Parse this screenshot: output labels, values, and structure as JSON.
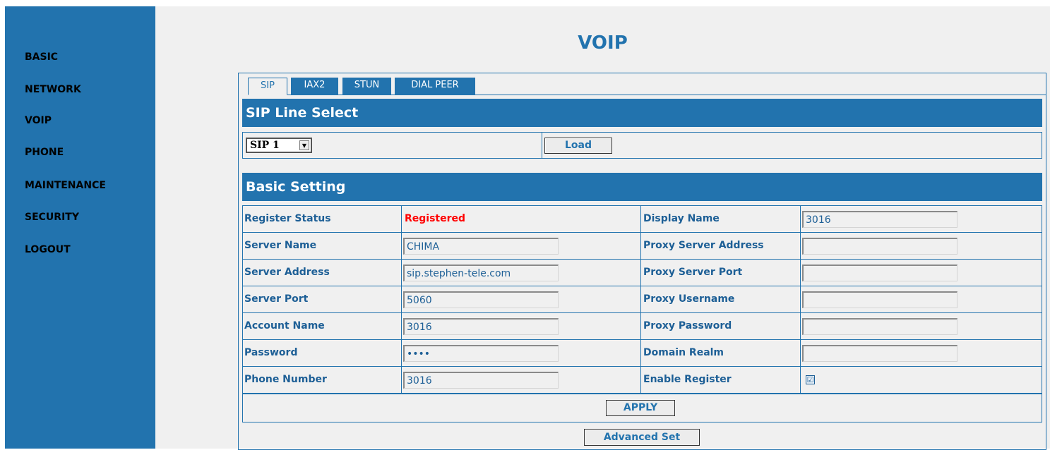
{
  "sidebar": {
    "items": [
      "BASIC",
      "NETWORK",
      "VOIP",
      "PHONE",
      "MAINTENANCE",
      "SECURITY",
      "LOGOUT"
    ]
  },
  "page": {
    "title": "VOIP"
  },
  "tabs": [
    "SIP",
    "IAX2",
    "STUN",
    "DIAL PEER"
  ],
  "active_tab": "SIP",
  "line_select": {
    "header": "SIP Line Select",
    "selected": "SIP 1",
    "load_label": "Load"
  },
  "basic_setting": {
    "header": "Basic Setting",
    "rows": [
      {
        "left_label": "Register Status",
        "left_value": "Registered",
        "right_label": "Display Name",
        "right_value": "3016"
      },
      {
        "left_label": "Server Name",
        "left_value": "CHIMA",
        "right_label": "Proxy Server Address",
        "right_value": ""
      },
      {
        "left_label": "Server Address",
        "left_value": "sip.stephen-tele.com",
        "right_label": "Proxy Server Port",
        "right_value": ""
      },
      {
        "left_label": "Server Port",
        "left_value": "5060",
        "right_label": "Proxy Username",
        "right_value": ""
      },
      {
        "left_label": "Account Name",
        "left_value": "3016",
        "right_label": "Proxy Password",
        "right_value": ""
      },
      {
        "left_label": "Password",
        "left_value": "••••",
        "right_label": "Domain Realm",
        "right_value": ""
      },
      {
        "left_label": "Phone Number",
        "left_value": "3016",
        "right_label": "Enable Register",
        "right_value": "☑"
      }
    ],
    "enable_register_checked": true
  },
  "buttons": {
    "apply": "APPLY",
    "advanced": "Advanced Set"
  },
  "colors": {
    "accent": "#2273ae",
    "status_registered": "#ff0000",
    "background": "#f0f0f0"
  }
}
